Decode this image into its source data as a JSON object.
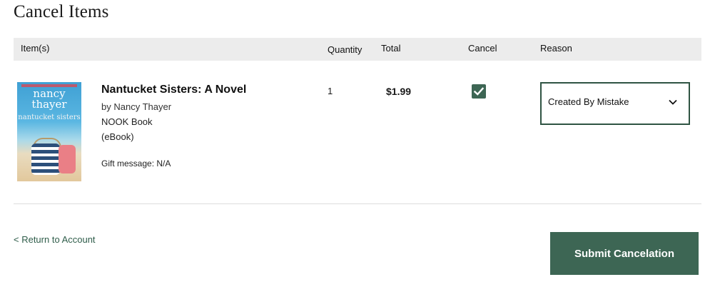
{
  "page": {
    "title": "Cancel Items"
  },
  "table_header": {
    "items": "Item(s)",
    "quantity": "Quantity",
    "total": "Total",
    "cancel": "Cancel",
    "reason": "Reason"
  },
  "item": {
    "cover": {
      "author_text": "nancy thayer",
      "title_text": "nantucket sisters"
    },
    "title": "Nantucket Sisters: A Novel",
    "author": "by Nancy Thayer",
    "format": "NOOK Book",
    "format_type": "(eBook)",
    "gift_label": "Gift message:",
    "gift_value": "N/A",
    "quantity": "1",
    "total": "$1.99",
    "cancel_checked": true,
    "reason": {
      "selected": "Created By Mistake"
    }
  },
  "footer": {
    "return_link": "< Return to Account",
    "submit_label": "Submit Cancelation"
  },
  "colors": {
    "accent": "#3d6654",
    "header_bg": "#ececec"
  }
}
